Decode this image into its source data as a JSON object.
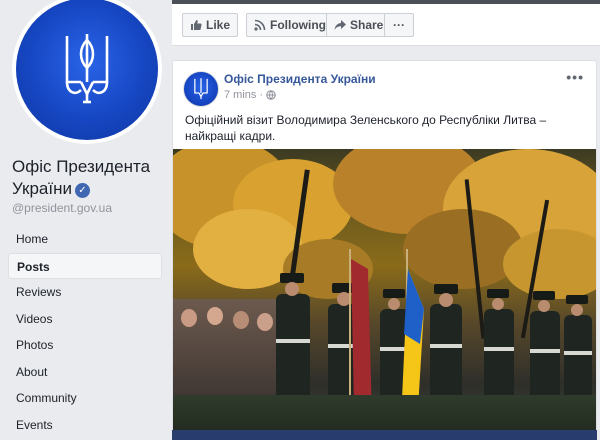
{
  "page": {
    "name": "Офіс Президента України",
    "handle": "@president.gov.ua",
    "verified": true
  },
  "nav": {
    "items": [
      {
        "label": "Home",
        "active": false
      },
      {
        "label": "Posts",
        "active": true
      },
      {
        "label": "Reviews",
        "active": false
      },
      {
        "label": "Videos",
        "active": false
      },
      {
        "label": "Photos",
        "active": false
      },
      {
        "label": "About",
        "active": false
      },
      {
        "label": "Community",
        "active": false
      },
      {
        "label": "Events",
        "active": false
      }
    ]
  },
  "actions": {
    "like_label": "Like",
    "following_label": "Following",
    "share_label": "Share",
    "more_label": "···"
  },
  "post": {
    "author": "Офіс Президента України",
    "time": "7 mins",
    "separator": "·",
    "more_label": "•••",
    "text": "Офіційний візит Володимира Зеленського до Республіки Литва – найкращі кадри."
  },
  "colors": {
    "brand_blue": "#4267b2",
    "link_blue": "#365899",
    "crest_blue": "#1646c2",
    "ukraine_blue": "#1f5fc8",
    "ukraine_yellow": "#f5c518",
    "lithuania_red": "#a12a2f"
  }
}
